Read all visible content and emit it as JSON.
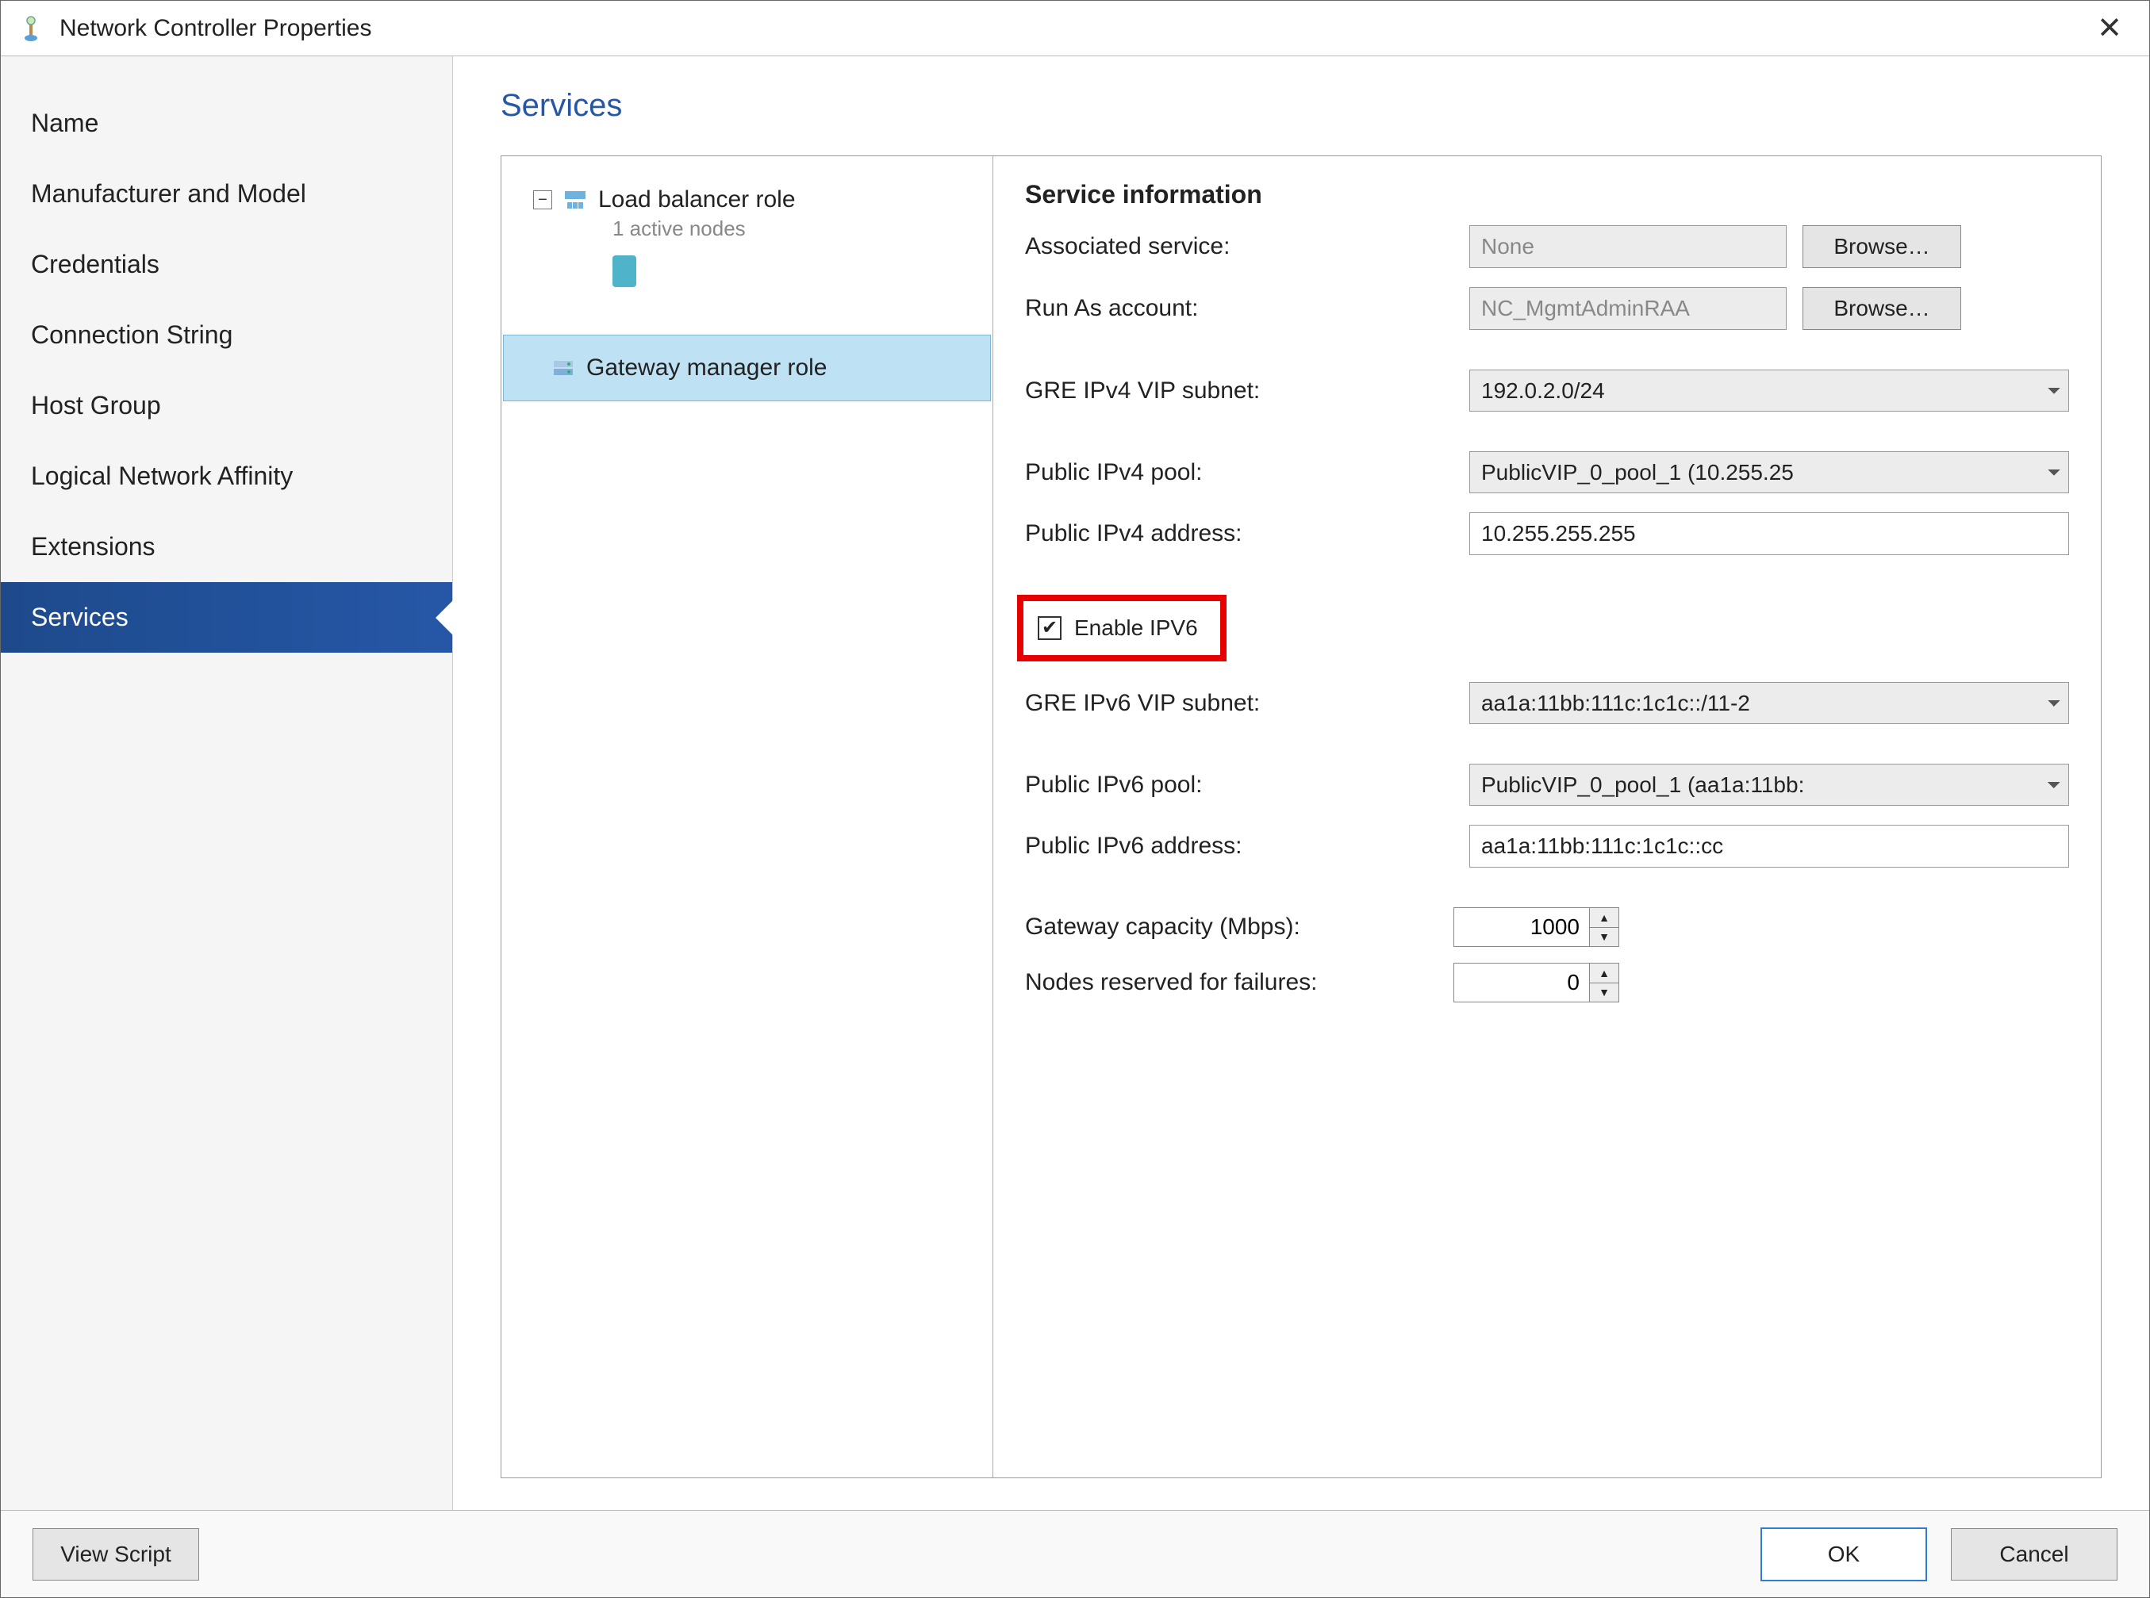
{
  "window": {
    "title": "Network Controller Properties"
  },
  "sidebar": {
    "items": [
      {
        "label": "Name"
      },
      {
        "label": "Manufacturer and Model"
      },
      {
        "label": "Credentials"
      },
      {
        "label": "Connection String"
      },
      {
        "label": "Host Group"
      },
      {
        "label": "Logical Network Affinity"
      },
      {
        "label": "Extensions"
      },
      {
        "label": "Services",
        "active": true
      }
    ]
  },
  "page": {
    "title": "Services"
  },
  "tree": {
    "lb_role": {
      "label": "Load balancer role",
      "sub": "1 active nodes"
    },
    "gw_role": {
      "label": "Gateway manager role"
    }
  },
  "info": {
    "heading": "Service information",
    "assoc_label": "Associated service:",
    "assoc_value": "None",
    "browse": "Browse…",
    "runas_label": "Run As account:",
    "runas_value": "NC_MgmtAdminRAA",
    "gre4_label": "GRE IPv4 VIP subnet:",
    "gre4_value": "192.0.2.0/24",
    "pub4pool_label": "Public IPv4 pool:",
    "pub4pool_value": "PublicVIP_0_pool_1 (10.255.25",
    "pub4addr_label": "Public IPv4 address:",
    "pub4addr_value": "10.255.255.255",
    "enable_ipv6_label": "Enable IPV6",
    "enable_ipv6_checked": true,
    "gre6_label": "GRE IPv6 VIP subnet:",
    "gre6_value": "aa1a:11bb:111c:1c1c::/11-2",
    "pub6pool_label": "Public IPv6 pool:",
    "pub6pool_value": "PublicVIP_0_pool_1 (aa1a:11bb:",
    "pub6addr_label": "Public IPv6 address:",
    "pub6addr_value": "aa1a:11bb:111c:1c1c::cc",
    "capacity_label": "Gateway capacity (Mbps):",
    "capacity_value": "1000",
    "reserved_label": "Nodes reserved for failures:",
    "reserved_value": "0"
  },
  "footer": {
    "view_script": "View Script",
    "ok": "OK",
    "cancel": "Cancel"
  }
}
